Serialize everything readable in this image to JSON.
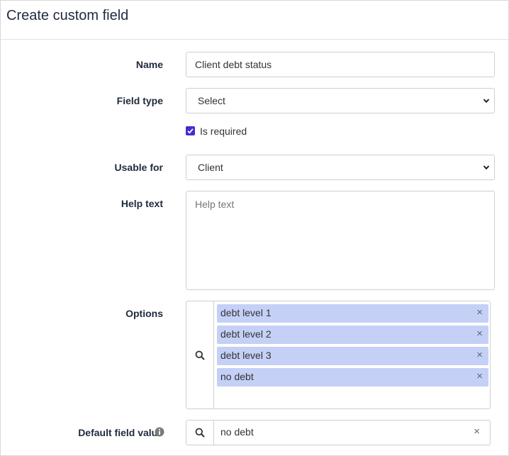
{
  "title": "Create custom field",
  "form": {
    "name": {
      "label": "Name",
      "value": "Client debt status"
    },
    "field_type": {
      "label": "Field type",
      "value": "Select"
    },
    "is_required": {
      "label": "Is required",
      "checked": true
    },
    "usable_for": {
      "label": "Usable for",
      "value": "Client"
    },
    "help_text": {
      "label": "Help text",
      "placeholder": "Help text"
    },
    "options": {
      "label": "Options",
      "items": [
        "debt level 1",
        "debt level 2",
        "debt level 3",
        "no debt"
      ],
      "remove_glyph": "×"
    },
    "default_value": {
      "label": "Default field value",
      "value": "no debt",
      "clear_glyph": "×"
    }
  },
  "colors": {
    "accent": "#4a2bd0",
    "tag_bg": "#c5d0f7",
    "border": "#cfcfcf",
    "heading": "#1f2a3d"
  },
  "icons": {
    "search": "search-icon",
    "chevron": "chevron-down-icon",
    "info": "info-icon",
    "check": "check-icon"
  }
}
